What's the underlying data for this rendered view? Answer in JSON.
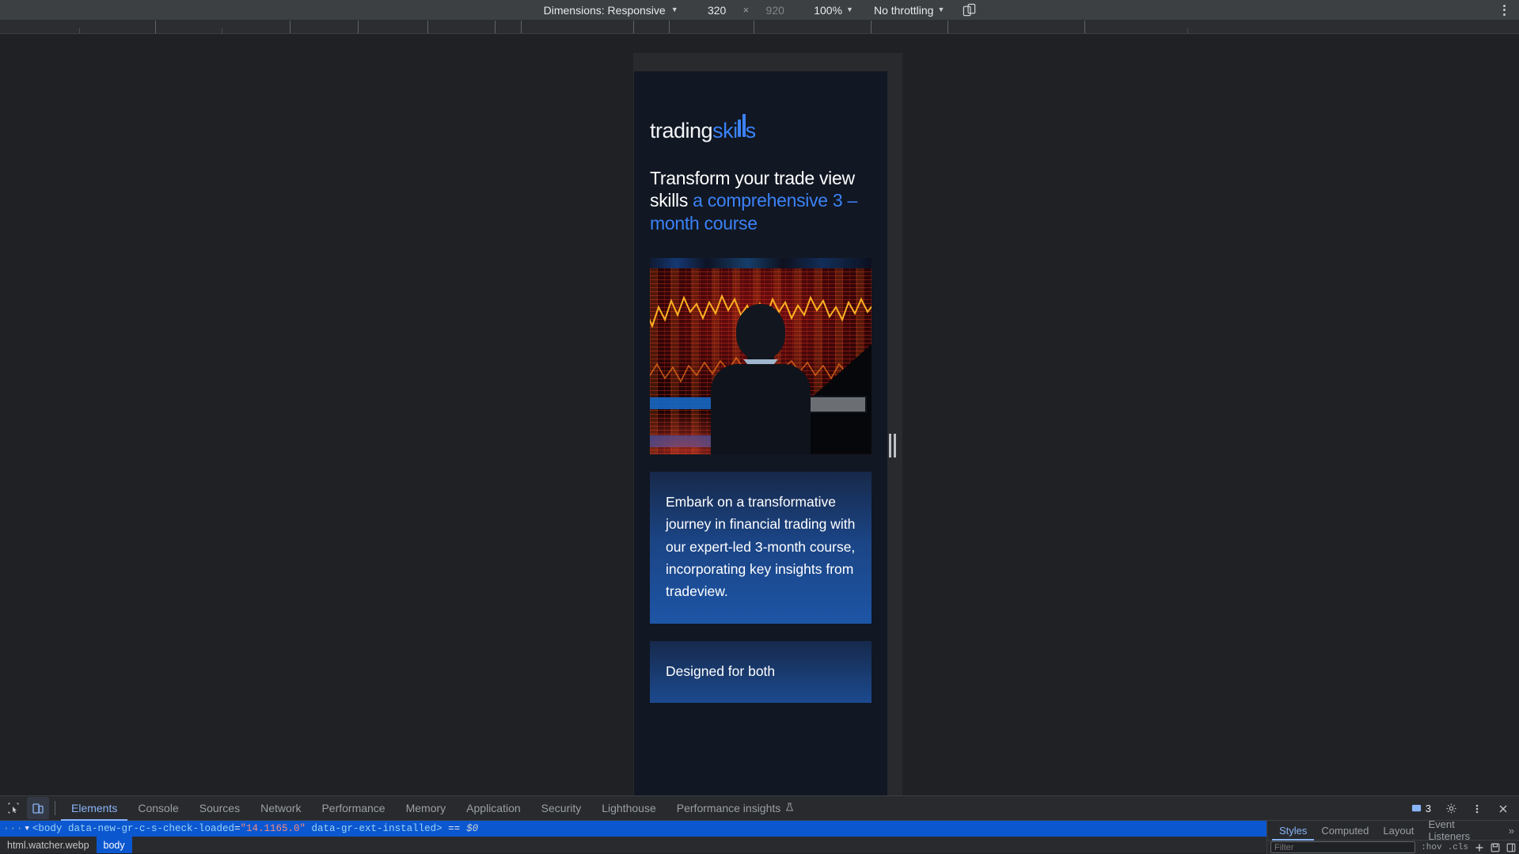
{
  "device_toolbar": {
    "dimensions_label": "Dimensions: Responsive",
    "width_value": "320",
    "height_value": "920",
    "multiply_symbol": "×",
    "zoom_value": "100%",
    "throttling_value": "No throttling",
    "rotate_icon": "rotate-device-icon",
    "kebab_icon": "more-options-icon"
  },
  "page": {
    "logo": {
      "part_white": "trading",
      "part_blue": "ski",
      "part_tail": "s"
    },
    "headline": {
      "white_text": "Transform your trade view skills ",
      "blue_text": "a comprehensive 3 – month course"
    },
    "hero_image_alt": "trader-at-trading-desk-image",
    "card_1_text": "Embark on a transformative journey in financial trading with our expert-led 3-month course, incorporating key insights from tradeview.",
    "card_2_text": "Designed for both"
  },
  "devtools": {
    "inspect_icon": "inspect-element-icon",
    "device_toolbar_icon": "toggle-device-toolbar-icon",
    "tabs": [
      {
        "label": "Elements",
        "active": true
      },
      {
        "label": "Console",
        "active": false
      },
      {
        "label": "Sources",
        "active": false
      },
      {
        "label": "Network",
        "active": false
      },
      {
        "label": "Performance",
        "active": false
      },
      {
        "label": "Memory",
        "active": false
      },
      {
        "label": "Application",
        "active": false
      },
      {
        "label": "Security",
        "active": false
      },
      {
        "label": "Lighthouse",
        "active": false
      },
      {
        "label": "Performance insights",
        "active": false
      }
    ],
    "performance_insights_flask_icon": "flask-icon",
    "message_count": "3",
    "settings_icon": "gear-icon",
    "more_icon": "more-options-icon",
    "close_icon": "close-icon",
    "dom_node": {
      "ellipsis": "···",
      "triangle": "▼",
      "open_tag": "<body",
      "attr_1_name": "data-new-gr-c-s-check-loaded",
      "attr_1_value": "\"14.1165.0\"",
      "attr_2_name": "data-gr-ext-installed",
      "close_tag": ">",
      "equals": "==",
      "ref": "$0"
    },
    "breadcrumbs": [
      {
        "label": "html.watcher.webp",
        "active": false
      },
      {
        "label": "body",
        "active": true
      }
    ],
    "styles_tabs": [
      {
        "label": "Styles",
        "active": true
      },
      {
        "label": "Computed",
        "active": false
      },
      {
        "label": "Layout",
        "active": false
      },
      {
        "label": "Event Listeners",
        "active": false
      }
    ],
    "styles_more": "»",
    "filter_placeholder": "Filter",
    "hov_chip": ":hov",
    "cls_chip": ".cls",
    "plus_icon": "add-style-rule-icon",
    "save_icon": "save-icon",
    "layout_icon": "computed-sidebar-icon"
  },
  "colors": {
    "accent_blue": "#3b82f6",
    "devtools_accent": "#8ab4f8",
    "selection_blue": "#0b57d0",
    "page_bg": "#111723",
    "card_blue": "#1d55a6"
  }
}
